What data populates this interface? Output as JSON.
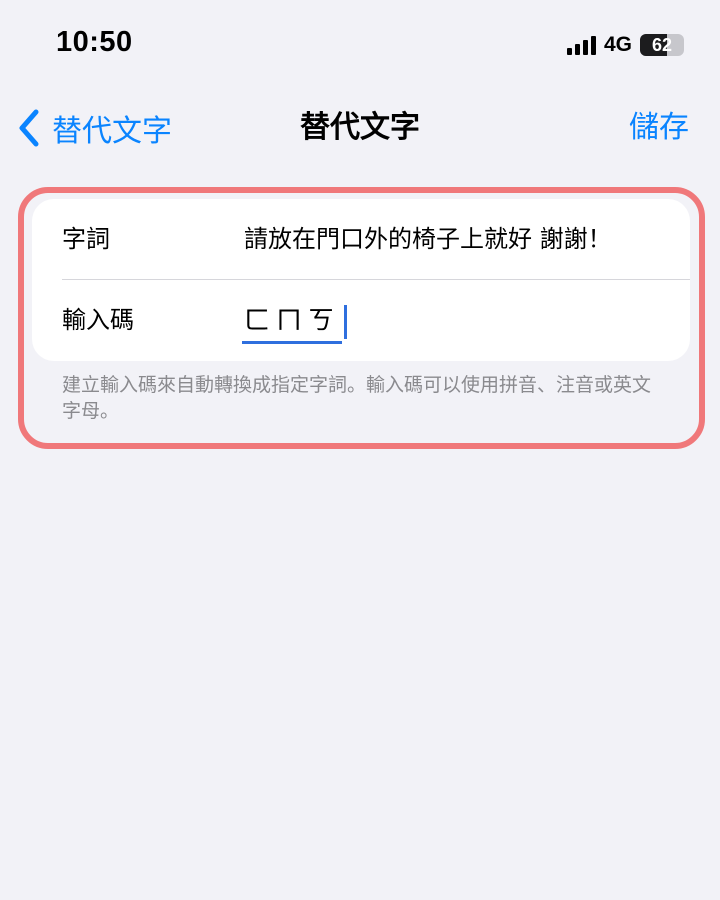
{
  "status_bar": {
    "time": "10:50",
    "network": "4G",
    "battery": "62",
    "battery_level": 0.62
  },
  "nav": {
    "back_label": "替代文字",
    "title": "替代文字",
    "save_label": "儲存",
    "accent_color": "#0a84ff"
  },
  "form": {
    "phrase_label": "字詞",
    "phrase_value": "請放在門口外的椅子上就好 謝謝！",
    "shortcut_label": "輸入碼",
    "shortcut_value": "ㄈㄇㄎ"
  },
  "footer": {
    "note": "建立輸入碼來自動轉換成指定字詞。輸入碼可以使用拼音、注音或英文字母。"
  },
  "highlight_color": "#f0787a"
}
